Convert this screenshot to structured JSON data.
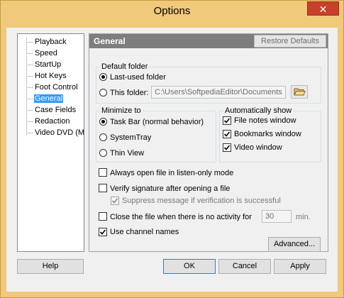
{
  "window": {
    "title": "Options",
    "close_glyph": "✕"
  },
  "tree": {
    "items": [
      {
        "label": "Playback",
        "selected": false
      },
      {
        "label": "Speed",
        "selected": false
      },
      {
        "label": "StartUp",
        "selected": false
      },
      {
        "label": "Hot Keys",
        "selected": false
      },
      {
        "label": "Foot Control",
        "selected": false
      },
      {
        "label": "General",
        "selected": true
      },
      {
        "label": "Case Fields",
        "selected": false
      },
      {
        "label": "Redaction",
        "selected": false
      },
      {
        "label": "Video DVD (MP",
        "selected": false
      }
    ]
  },
  "panel": {
    "title": "General",
    "restore_label": "Restore Defaults",
    "default_folder": {
      "label": "Default folder",
      "last_used_label": "Last-used folder",
      "last_used_selected": true,
      "this_folder_label": "This folder:",
      "this_folder_selected": false,
      "path_value": "C:\\Users\\SoftpediaEditor\\Documents"
    },
    "minimize_to": {
      "label": "Minimize to",
      "options": [
        {
          "label": "Task Bar (normal behavior)",
          "selected": true
        },
        {
          "label": "SystemTray",
          "selected": false
        },
        {
          "label": "Thin View",
          "selected": false
        }
      ]
    },
    "auto_show": {
      "label": "Automatically show",
      "options": [
        {
          "label": "File notes window",
          "checked": true
        },
        {
          "label": "Bookmarks window",
          "checked": true
        },
        {
          "label": "Video window",
          "checked": true
        }
      ]
    },
    "always_open_label": "Always open file in listen-only mode",
    "always_open_checked": false,
    "verify_label": "Verify signature after opening a file",
    "verify_checked": false,
    "suppress_label": "Suppress message if verification is successful",
    "suppress_checked": true,
    "close_file_label": "Close the file when there is no activity for",
    "close_file_checked": false,
    "close_file_minutes": "30",
    "close_file_unit": "min.",
    "channel_names_label": "Use channel names",
    "channel_names_checked": true,
    "advanced_label": "Advanced..."
  },
  "buttons": {
    "help": "Help",
    "ok": "OK",
    "cancel": "Cancel",
    "apply": "Apply"
  },
  "colors": {
    "accent": "#3399ff",
    "frame": "#f0c97a",
    "close": "#c7402b"
  },
  "icons": {
    "folder": "folder-open-icon",
    "close": "close-icon",
    "check": "checkmark-icon"
  }
}
